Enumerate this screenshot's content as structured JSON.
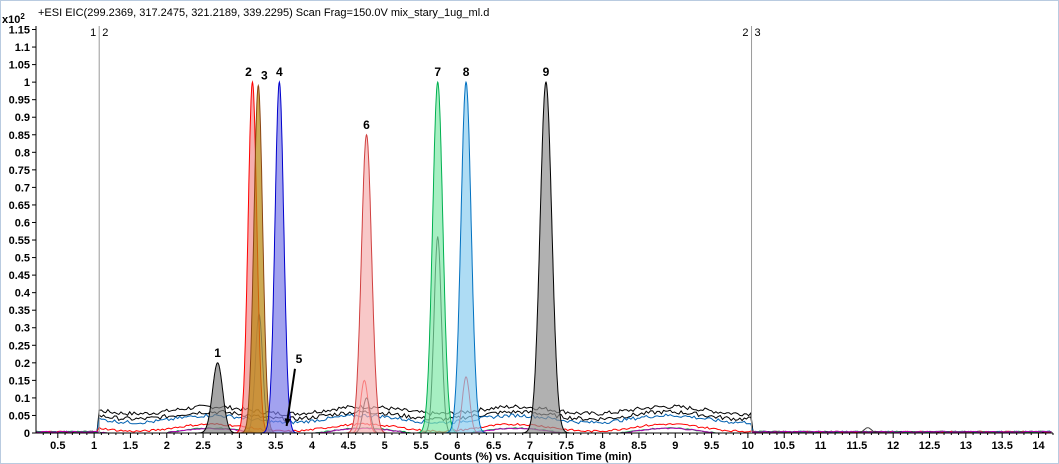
{
  "chart_data": {
    "type": "line",
    "header": "+ESI EIC(299.2369, 317.2475, 321.2189, 339.2295) Scan Frag=150.0V mix_stary_1ug_ml.d",
    "y_multiplier_label": "x10",
    "y_multiplier_exponent": "2",
    "xlabel": "Counts (%) vs. Acquisition Time (min)",
    "ylabel": "",
    "xlim": [
      0.2,
      14.2
    ],
    "ylim": [
      0,
      1.16
    ],
    "x_ticks": [
      "0.5",
      "1",
      "1.5",
      "2",
      "2.5",
      "3",
      "3.5",
      "4",
      "4.5",
      "5",
      "5.5",
      "6",
      "6.5",
      "7",
      "7.5",
      "8",
      "8.5",
      "9",
      "9.5",
      "10",
      "10.5",
      "11",
      "11.5",
      "12",
      "12.5",
      "13",
      "13.5",
      "14"
    ],
    "y_ticks": [
      "0",
      "0.05",
      "0.1",
      "0.15",
      "0.2",
      "0.25",
      "0.3",
      "0.35",
      "0.4",
      "0.45",
      "0.5",
      "0.55",
      "0.6",
      "0.65",
      "0.7",
      "0.75",
      "0.8",
      "0.85",
      "0.9",
      "0.95",
      "1",
      "1.05",
      "1.1",
      "1.15"
    ],
    "markers": [
      {
        "label_left": "1",
        "label_right": "2",
        "x": 1.07
      },
      {
        "label_left": "2",
        "label_right": "3",
        "x": 10.05
      }
    ],
    "peaks": [
      {
        "label": "1",
        "x": 2.7,
        "height": 0.2,
        "width": 0.07,
        "color": "#000000",
        "fill": "#808080"
      },
      {
        "label": "2",
        "x": 3.18,
        "height": 1.0,
        "width": 0.06,
        "color": "#ff0000",
        "fill": "#f28b8b"
      },
      {
        "label": "3",
        "x": 3.26,
        "height": 0.99,
        "width": 0.06,
        "color": "#8b4513",
        "fill": "#b8860b"
      },
      {
        "label": "4",
        "x": 3.55,
        "height": 1.0,
        "width": 0.06,
        "color": "#0000cc",
        "fill": "#7b7be8"
      },
      {
        "label": "6",
        "x": 4.75,
        "height": 0.85,
        "width": 0.07,
        "color": "#d04040",
        "fill": "#f5b0b0"
      },
      {
        "label": "7",
        "x": 5.73,
        "height": 1.0,
        "width": 0.07,
        "color": "#00b050",
        "fill": "#80e8a8"
      },
      {
        "label": "8",
        "x": 6.12,
        "height": 1.0,
        "width": 0.07,
        "color": "#0070c0",
        "fill": "#8ccdf0"
      },
      {
        "label": "9",
        "x": 7.22,
        "height": 1.0,
        "width": 0.08,
        "color": "#000000",
        "fill": "#909090"
      }
    ],
    "annotations": [
      {
        "label": "5",
        "x": 3.82,
        "y": 0.2,
        "arrow_to_x": 3.65,
        "arrow_to_y": 0.02
      }
    ],
    "grid": false
  }
}
